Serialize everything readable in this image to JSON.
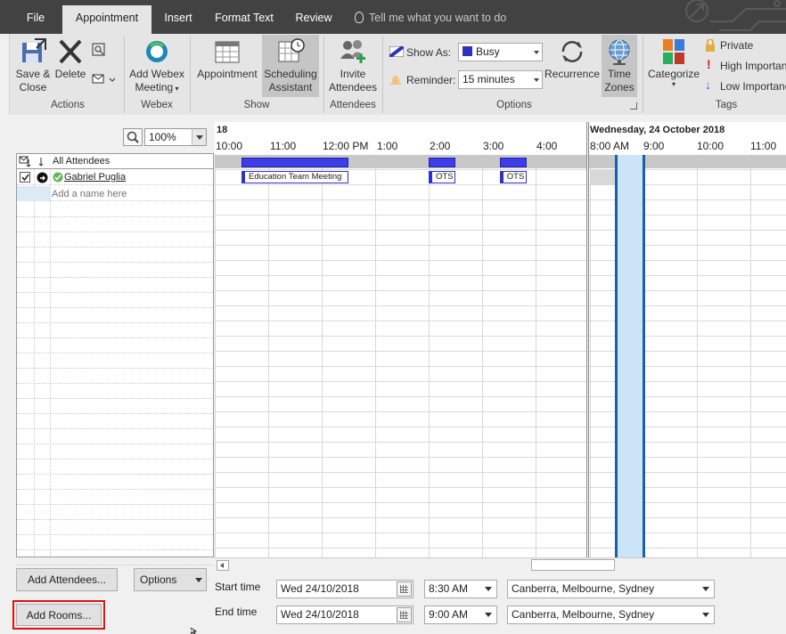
{
  "tabs": [
    {
      "label": "File",
      "active": false
    },
    {
      "label": "Appointment",
      "active": true
    },
    {
      "label": "Insert",
      "active": false
    },
    {
      "label": "Format Text",
      "active": false
    },
    {
      "label": "Review",
      "active": false
    }
  ],
  "tell_me": "Tell me what you want to do",
  "ribbon": {
    "actions": {
      "save_close": "Save & Close",
      "delete": "Delete",
      "group": "Actions"
    },
    "webex": {
      "add_meeting": "Add Webex Meeting",
      "group": "Webex"
    },
    "show": {
      "appointment": "Appointment",
      "scheduling": "Scheduling Assistant",
      "group": "Show"
    },
    "attendees": {
      "invite": "Invite Attendees",
      "group": "Attendees"
    },
    "options": {
      "show_as_label": "Show As:",
      "show_as_value": "Busy",
      "reminder_label": "Reminder:",
      "reminder_value": "15 minutes",
      "recurrence": "Recurrence",
      "time_zones": "Time Zones",
      "group": "Options"
    },
    "tags": {
      "categorize": "Categorize",
      "private": "Private",
      "high_importance": "High Importance",
      "low_importance": "Low Importance",
      "group": "Tags"
    }
  },
  "zoom": {
    "value": "100%"
  },
  "attendees_panel": {
    "all_attendees": "All Attendees",
    "attendee_name": "Gabriel Puglia",
    "add_placeholder": "Add a name here"
  },
  "timeline": {
    "left_day_fragment": "18",
    "right_day": "Wednesday, 24 October 2018",
    "hours_left": [
      "10:00",
      "11:00",
      "12:00 PM",
      "1:00",
      "2:00",
      "3:00",
      "4:00"
    ],
    "hours_right": [
      "8:00 AM",
      "9:00",
      "10:00",
      "11:00"
    ],
    "meetings": [
      {
        "label": "Education Team Meeting",
        "start": 10.5,
        "end": 12.5
      },
      {
        "label": "OTS",
        "start": 14.0,
        "end": 14.5
      },
      {
        "label": "OTS",
        "start": 15.33,
        "end": 15.83
      }
    ],
    "selection": {
      "start": "8:30 AM",
      "end": "9:00 AM"
    }
  },
  "bottom": {
    "add_attendees": "Add Attendees...",
    "options": "Options",
    "add_rooms": "Add Rooms...",
    "start_time_label": "Start time",
    "end_time_label": "End time",
    "start_date": "Wed 24/10/2018",
    "start_time": "8:30 AM",
    "end_date": "Wed 24/10/2018",
    "end_time": "9:00 AM",
    "start_tz": "Canberra, Melbourne, Sydney",
    "end_tz": "Canberra, Melbourne, Sydney"
  },
  "colors": {
    "busy": "#3e3ee8",
    "selection": "#cce4f7",
    "selection_border": "#1c5fa8",
    "highlight": "#dd1111"
  }
}
